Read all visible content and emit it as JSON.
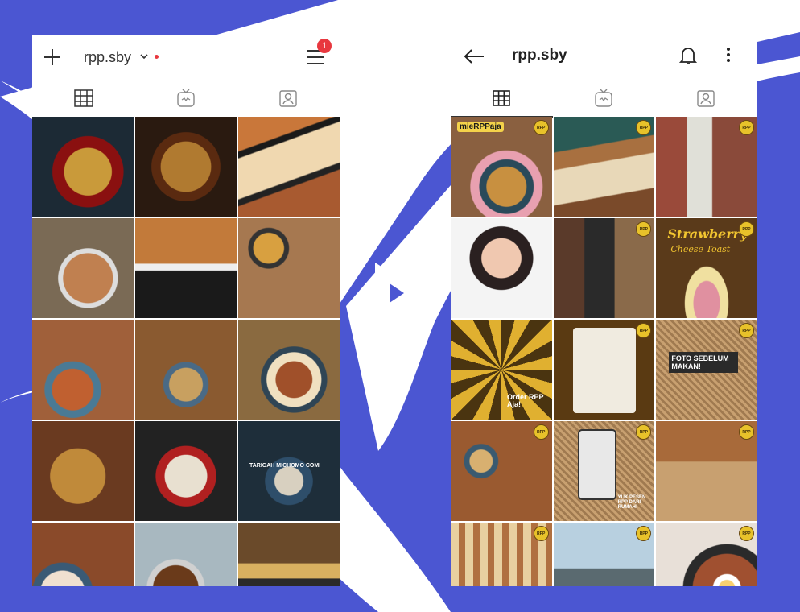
{
  "colors": {
    "background": "#4b56d2",
    "accent": "#e8383f",
    "post_badge": "#e8c22a"
  },
  "left_screen": {
    "username": "rpp.sby",
    "notification_count": "1",
    "icons": [
      "plus-icon",
      "chevron-down-icon",
      "menu-icon",
      "grid-icon",
      "igtv-icon",
      "tagged-icon"
    ],
    "post_texts": {
      "r1c3": "",
      "r2c2": "",
      "r4c3": "TARIGAH MICHOMO COMI"
    }
  },
  "right_screen": {
    "username": "rpp.sby",
    "icons": [
      "back-arrow-icon",
      "bell-icon",
      "more-vertical-icon",
      "grid-icon",
      "igtv-icon",
      "tagged-icon"
    ],
    "badge_text": "RPP",
    "post_texts": {
      "r1c1": "mieRPPaja",
      "r2c3_title": "Strawberry",
      "r2c3_sub": "Cheese Toast",
      "r3c1": "Order RPP Aja!",
      "r3c3_title": "FOTO SEBELUM MAKAN!",
      "r4c2": "YUK PESEN RPP DARI RUMAH!"
    }
  },
  "center_icon": "play-arrow-icon"
}
